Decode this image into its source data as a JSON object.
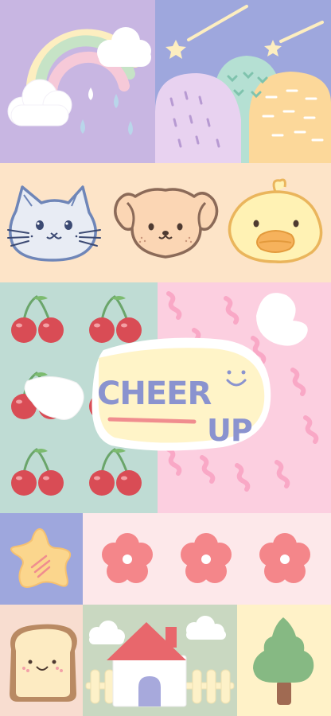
{
  "wallpaper": {
    "badge": {
      "line1": "CHEER",
      "line2": "UP"
    }
  },
  "palette": {
    "lavender": "#c8b6e2",
    "periwinkle": "#9ea7dd",
    "peach": "#fde4c8",
    "mint": "#bfdcd4",
    "pink": "#fccfe0",
    "cream": "#fff4c8",
    "coral": "#f08d8f",
    "sage": "#c9d8c1",
    "cherry_red": "#d94c55",
    "star_yellow": "#fbd68d"
  },
  "icons": [
    "rainbow-icon",
    "cloud-icon",
    "raindrop-icon",
    "shooting-star-icon",
    "hills-icon",
    "cat-face-icon",
    "puppy-face-icon",
    "duckling-face-icon",
    "cherry-icon",
    "heart-icon",
    "smiley-icon",
    "star-icon",
    "flower-icon",
    "toast-icon",
    "house-icon",
    "fence-icon",
    "tree-icon"
  ]
}
